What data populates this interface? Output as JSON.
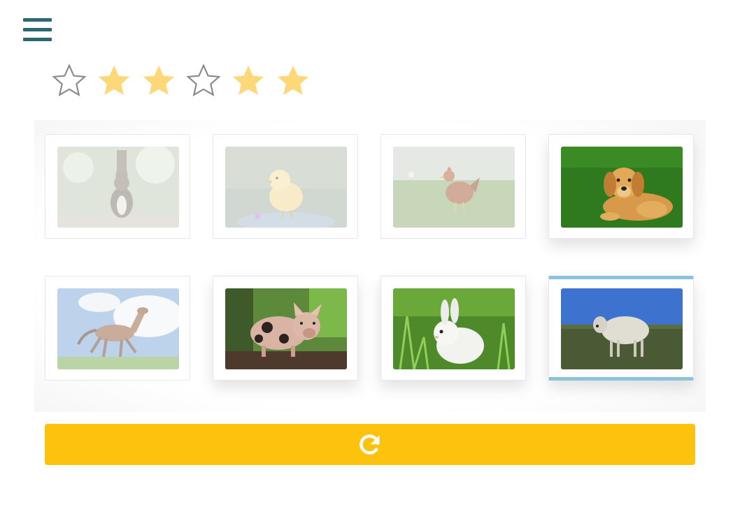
{
  "menu": {
    "icon": "hamburger-menu-icon"
  },
  "rating": {
    "value": 4,
    "max": 6,
    "stars": [
      {
        "icon": "star-outline-icon",
        "filled": false
      },
      {
        "icon": "star-filled-icon",
        "filled": true
      },
      {
        "icon": "star-filled-icon",
        "filled": true
      },
      {
        "icon": "star-outline-icon",
        "filled": false
      },
      {
        "icon": "star-filled-icon",
        "filled": true
      },
      {
        "icon": "star-filled-icon",
        "filled": true
      }
    ],
    "filled_color": "#fcd879",
    "empty_color": "#888888"
  },
  "cards": [
    {
      "animal": "cat",
      "faded": true,
      "selected": false
    },
    {
      "animal": "chick",
      "faded": true,
      "selected": false
    },
    {
      "animal": "hen",
      "faded": true,
      "selected": false
    },
    {
      "animal": "dog",
      "faded": false,
      "selected": false
    },
    {
      "animal": "horse",
      "faded": true,
      "selected": false
    },
    {
      "animal": "pig",
      "faded": false,
      "selected": false
    },
    {
      "animal": "rabbit",
      "faded": false,
      "selected": false
    },
    {
      "animal": "sheep",
      "faded": false,
      "selected": true
    }
  ],
  "reload_button": {
    "icon": "reload-icon",
    "color": "#fdc20e"
  },
  "colors": {
    "menu": "#2b6873",
    "selected_border": "#8cc3dc"
  }
}
